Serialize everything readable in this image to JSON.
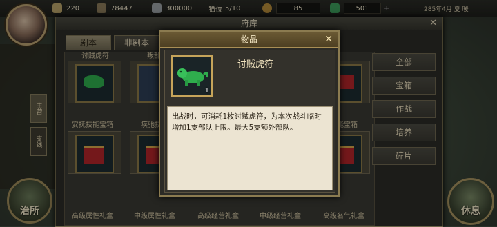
{
  "topbar": {
    "resources": [
      {
        "icon": "food-icon",
        "value": "220",
        "color": "#b9a36a"
      },
      {
        "icon": "wood-icon",
        "value": "78447",
        "color": "#8a7a5a"
      },
      {
        "icon": "silver-icon",
        "value": "300000",
        "color": "#9aa0a4"
      },
      {
        "icon": "people-icon",
        "label": "猫位",
        "value": "5/10",
        "color": "#c9b98a"
      },
      {
        "icon": "gold-icon",
        "value": "85",
        "color": "#b48a3a"
      },
      {
        "icon": "jade-icon",
        "value": "501",
        "color": "#3c9b5b"
      }
    ],
    "date_text": "285年4月 夏 暖"
  },
  "left": {
    "tab_labels": [
      "主营",
      "支线"
    ],
    "home_label": "治所"
  },
  "warehouse": {
    "title": "府库",
    "tabs": [
      {
        "label": "剧本",
        "active": true
      },
      {
        "label": "非剧本",
        "active": false
      }
    ],
    "row1_labels": [
      "讨贼虎符",
      "叛乱令",
      "",
      "",
      ""
    ],
    "row2_labels": [
      "安抚技能宝箱",
      "疾驰技能",
      "",
      "",
      "技能宝箱"
    ],
    "row3_labels": [
      "高级属性礼盒",
      "中级属性礼盒",
      "高级经营礼盒",
      "中级经营礼盒",
      "高级名气礼盒"
    ],
    "filters": [
      "全部",
      "宝箱",
      "作战",
      "培养",
      "碎片"
    ]
  },
  "right": {
    "rest_label": "休息"
  },
  "popup": {
    "title": "物品",
    "item_name": "讨贼虎符",
    "item_count": "1",
    "description": "出战时，可消耗1枚讨贼虎符，为本次战斗临时增加1支部队上限。最大5支额外部队。",
    "colors": {
      "border": "#8b7b50",
      "jade": "#2fae4d",
      "chest": "#b3262a"
    }
  }
}
